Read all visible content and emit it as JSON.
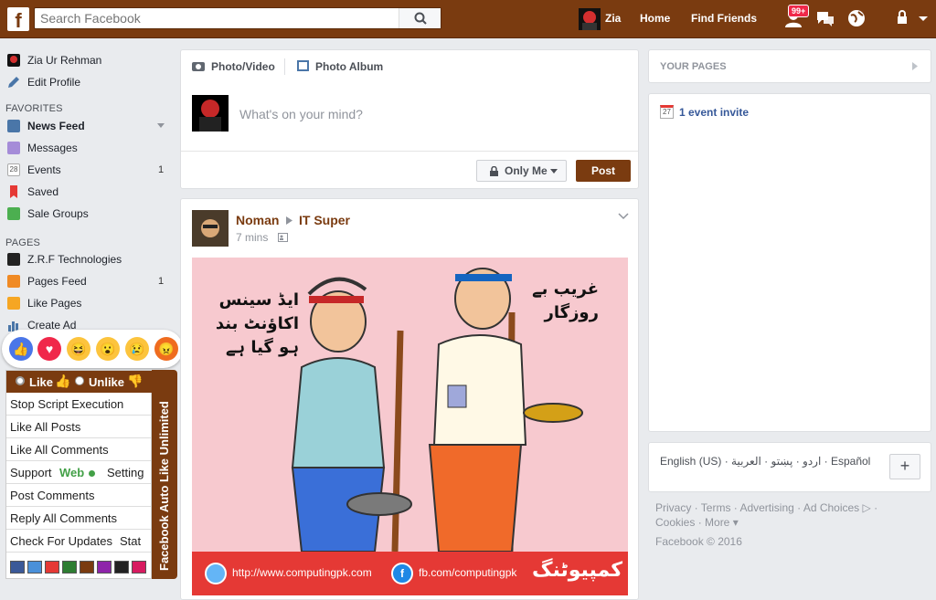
{
  "topbar": {
    "logo": "f",
    "search_placeholder": "Search Facebook",
    "profile_name": "Zia",
    "home": "Home",
    "find_friends": "Find Friends",
    "friend_requests_badge": "99+"
  },
  "left": {
    "profile": "Zia Ur Rehman",
    "edit_profile": "Edit Profile",
    "favorites_header": "FAVORITES",
    "favorites": [
      {
        "label": "News Feed",
        "count": ""
      },
      {
        "label": "Messages",
        "count": ""
      },
      {
        "label": "Events",
        "count": "1"
      },
      {
        "label": "Saved",
        "count": ""
      },
      {
        "label": "Sale Groups",
        "count": ""
      }
    ],
    "pages_header": "PAGES",
    "pages": [
      {
        "label": "Z.R.F Technologies",
        "count": ""
      },
      {
        "label": "Pages Feed",
        "count": "1"
      },
      {
        "label": "Like Pages",
        "count": ""
      },
      {
        "label": "Create Ad",
        "count": ""
      }
    ],
    "events_icon_num": "28"
  },
  "script_panel": {
    "like": "Like",
    "unlike": "Unlike",
    "items": [
      "Stop Script Execution",
      "Like All Posts",
      "Like All Comments",
      "Support",
      "Post Comments",
      "Reply All Comments",
      "Check For Updates"
    ],
    "support_web": "Web",
    "support_setting": "Setting",
    "updates_stat": "Stat",
    "side_title": "Facebook Auto Like Unlimited",
    "swatches": [
      "#3b5998",
      "#4a90d9",
      "#e53935",
      "#2e7d32",
      "#7a3b10",
      "#8e24aa",
      "#222222",
      "#d81b60"
    ]
  },
  "composer": {
    "photo_video": "Photo/Video",
    "photo_album": "Photo Album",
    "placeholder": "What's on your mind?",
    "audience": "Only Me",
    "post": "Post"
  },
  "post": {
    "author": "Noman",
    "target": "IT Super",
    "time": "7 mins",
    "left_caption_lines": [
      "ایڈ سینس",
      "اکاؤنٹ بند",
      "ہو گیا ہے"
    ],
    "right_caption_lines": [
      "غریب بے",
      "روزگار"
    ],
    "banner_url1": "http://www.computingpk.com",
    "banner_url2": "fb.com/computingpk",
    "banner_brand": "کمپیوٹنگ"
  },
  "right": {
    "your_pages": "YOUR PAGES",
    "event_invite": "1 event invite",
    "event_icon_num": "27",
    "languages": "English (US) · اردو · پښتو · العربية · Español",
    "footer": [
      "Privacy · Terms · Advertising · Ad Choices ▷ ·",
      "Cookies · More ▾",
      "Facebook © 2016"
    ]
  },
  "colors": {
    "brand": "#7a3b10",
    "background": "#e9ebee"
  }
}
